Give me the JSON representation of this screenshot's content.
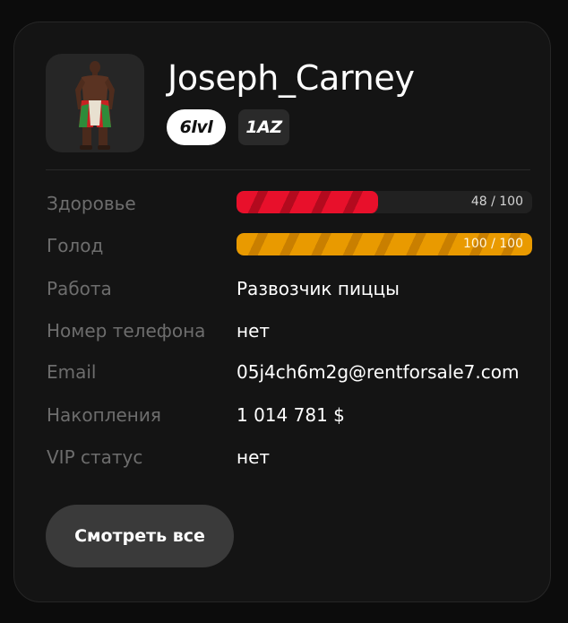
{
  "profile": {
    "username": "Joseph_Carney",
    "level_badge": "6lvl",
    "org_badge": "1AZ",
    "avatar_icon": "character-avatar-icon"
  },
  "stats": {
    "health": {
      "label": "Здоровье",
      "value": 48,
      "max": 100,
      "text": "48 / 100",
      "color": "#e8102b"
    },
    "hunger": {
      "label": "Голод",
      "value": 100,
      "max": 100,
      "text": "100 / 100",
      "color": "#e99a00"
    }
  },
  "info": {
    "job_label": "Работа",
    "job_value": "Развозчик пиццы",
    "phone_label": "Номер телефона",
    "phone_value": "нет",
    "email_label": "Email",
    "email_value": "05j4ch6m2g@rentforsale7.com",
    "savings_label": "Накопления",
    "savings_value": "1 014 781 $",
    "vip_label": "VIP статус",
    "vip_value": "нет"
  },
  "actions": {
    "view_all_label": "Смотреть все"
  }
}
